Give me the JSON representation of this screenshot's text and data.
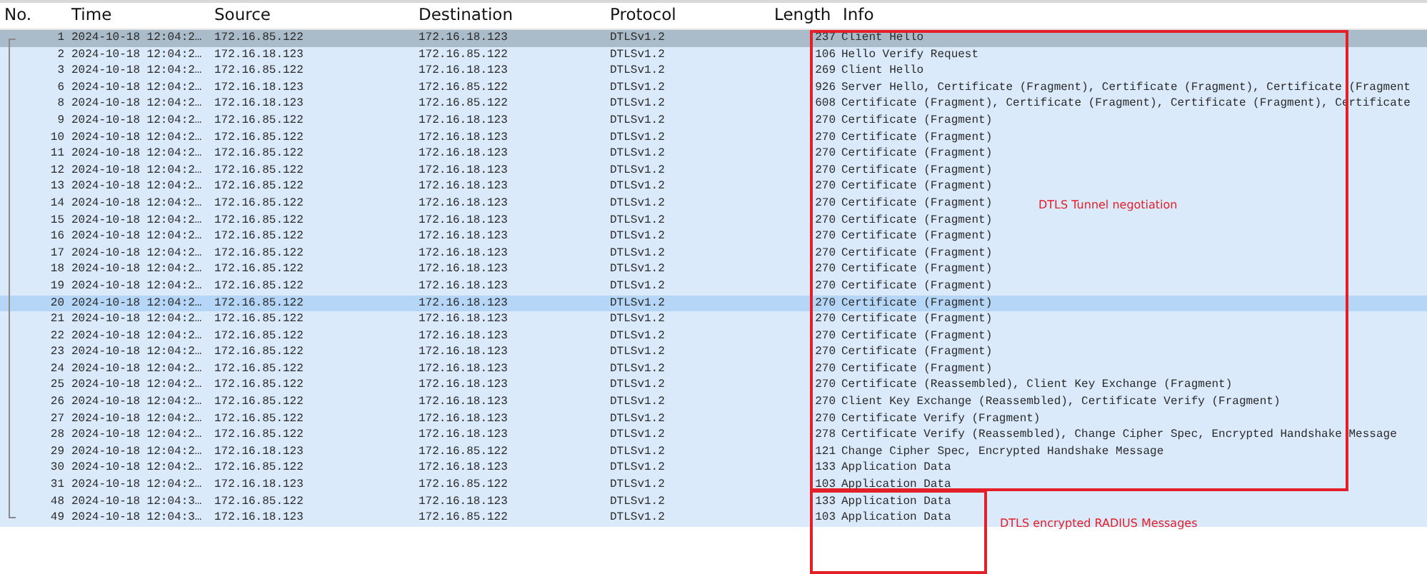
{
  "columns": [
    "No.",
    "Time",
    "Source",
    "Destination",
    "Protocol",
    "Length",
    "Info"
  ],
  "packets": [
    {
      "no": "1",
      "time": "2024-10-18 12:04:2…",
      "source": "172.16.85.122",
      "destination": "172.16.18.123",
      "protocol": "DTLSv1.2",
      "length": "237",
      "info": "Client Hello",
      "selected": true,
      "hovered": false
    },
    {
      "no": "2",
      "time": "2024-10-18 12:04:2…",
      "source": "172.16.18.123",
      "destination": "172.16.85.122",
      "protocol": "DTLSv1.2",
      "length": "106",
      "info": "Hello Verify Request",
      "selected": false,
      "hovered": false
    },
    {
      "no": "3",
      "time": "2024-10-18 12:04:2…",
      "source": "172.16.85.122",
      "destination": "172.16.18.123",
      "protocol": "DTLSv1.2",
      "length": "269",
      "info": "Client Hello",
      "selected": false,
      "hovered": false
    },
    {
      "no": "6",
      "time": "2024-10-18 12:04:2…",
      "source": "172.16.18.123",
      "destination": "172.16.85.122",
      "protocol": "DTLSv1.2",
      "length": "926",
      "info": "Server Hello, Certificate (Fragment), Certificate (Fragment), Certificate (Fragment",
      "selected": false,
      "hovered": false
    },
    {
      "no": "8",
      "time": "2024-10-18 12:04:2…",
      "source": "172.16.18.123",
      "destination": "172.16.85.122",
      "protocol": "DTLSv1.2",
      "length": "608",
      "info": "Certificate (Fragment), Certificate (Fragment), Certificate (Fragment), Certificate",
      "selected": false,
      "hovered": false
    },
    {
      "no": "9",
      "time": "2024-10-18 12:04:2…",
      "source": "172.16.85.122",
      "destination": "172.16.18.123",
      "protocol": "DTLSv1.2",
      "length": "270",
      "info": "Certificate (Fragment)",
      "selected": false,
      "hovered": false
    },
    {
      "no": "10",
      "time": "2024-10-18 12:04:2…",
      "source": "172.16.85.122",
      "destination": "172.16.18.123",
      "protocol": "DTLSv1.2",
      "length": "270",
      "info": "Certificate (Fragment)",
      "selected": false,
      "hovered": false
    },
    {
      "no": "11",
      "time": "2024-10-18 12:04:2…",
      "source": "172.16.85.122",
      "destination": "172.16.18.123",
      "protocol": "DTLSv1.2",
      "length": "270",
      "info": "Certificate (Fragment)",
      "selected": false,
      "hovered": false
    },
    {
      "no": "12",
      "time": "2024-10-18 12:04:2…",
      "source": "172.16.85.122",
      "destination": "172.16.18.123",
      "protocol": "DTLSv1.2",
      "length": "270",
      "info": "Certificate (Fragment)",
      "selected": false,
      "hovered": false
    },
    {
      "no": "13",
      "time": "2024-10-18 12:04:2…",
      "source": "172.16.85.122",
      "destination": "172.16.18.123",
      "protocol": "DTLSv1.2",
      "length": "270",
      "info": "Certificate (Fragment)",
      "selected": false,
      "hovered": false
    },
    {
      "no": "14",
      "time": "2024-10-18 12:04:2…",
      "source": "172.16.85.122",
      "destination": "172.16.18.123",
      "protocol": "DTLSv1.2",
      "length": "270",
      "info": "Certificate (Fragment)",
      "selected": false,
      "hovered": false
    },
    {
      "no": "15",
      "time": "2024-10-18 12:04:2…",
      "source": "172.16.85.122",
      "destination": "172.16.18.123",
      "protocol": "DTLSv1.2",
      "length": "270",
      "info": "Certificate (Fragment)",
      "selected": false,
      "hovered": false
    },
    {
      "no": "16",
      "time": "2024-10-18 12:04:2…",
      "source": "172.16.85.122",
      "destination": "172.16.18.123",
      "protocol": "DTLSv1.2",
      "length": "270",
      "info": "Certificate (Fragment)",
      "selected": false,
      "hovered": false
    },
    {
      "no": "17",
      "time": "2024-10-18 12:04:2…",
      "source": "172.16.85.122",
      "destination": "172.16.18.123",
      "protocol": "DTLSv1.2",
      "length": "270",
      "info": "Certificate (Fragment)",
      "selected": false,
      "hovered": false
    },
    {
      "no": "18",
      "time": "2024-10-18 12:04:2…",
      "source": "172.16.85.122",
      "destination": "172.16.18.123",
      "protocol": "DTLSv1.2",
      "length": "270",
      "info": "Certificate (Fragment)",
      "selected": false,
      "hovered": false
    },
    {
      "no": "19",
      "time": "2024-10-18 12:04:2…",
      "source": "172.16.85.122",
      "destination": "172.16.18.123",
      "protocol": "DTLSv1.2",
      "length": "270",
      "info": "Certificate (Fragment)",
      "selected": false,
      "hovered": false
    },
    {
      "no": "20",
      "time": "2024-10-18 12:04:2…",
      "source": "172.16.85.122",
      "destination": "172.16.18.123",
      "protocol": "DTLSv1.2",
      "length": "270",
      "info": "Certificate (Fragment)",
      "selected": false,
      "hovered": true
    },
    {
      "no": "21",
      "time": "2024-10-18 12:04:2…",
      "source": "172.16.85.122",
      "destination": "172.16.18.123",
      "protocol": "DTLSv1.2",
      "length": "270",
      "info": "Certificate (Fragment)",
      "selected": false,
      "hovered": false
    },
    {
      "no": "22",
      "time": "2024-10-18 12:04:2…",
      "source": "172.16.85.122",
      "destination": "172.16.18.123",
      "protocol": "DTLSv1.2",
      "length": "270",
      "info": "Certificate (Fragment)",
      "selected": false,
      "hovered": false
    },
    {
      "no": "23",
      "time": "2024-10-18 12:04:2…",
      "source": "172.16.85.122",
      "destination": "172.16.18.123",
      "protocol": "DTLSv1.2",
      "length": "270",
      "info": "Certificate (Fragment)",
      "selected": false,
      "hovered": false
    },
    {
      "no": "24",
      "time": "2024-10-18 12:04:2…",
      "source": "172.16.85.122",
      "destination": "172.16.18.123",
      "protocol": "DTLSv1.2",
      "length": "270",
      "info": "Certificate (Fragment)",
      "selected": false,
      "hovered": false
    },
    {
      "no": "25",
      "time": "2024-10-18 12:04:2…",
      "source": "172.16.85.122",
      "destination": "172.16.18.123",
      "protocol": "DTLSv1.2",
      "length": "270",
      "info": "Certificate (Reassembled), Client Key Exchange (Fragment)",
      "selected": false,
      "hovered": false
    },
    {
      "no": "26",
      "time": "2024-10-18 12:04:2…",
      "source": "172.16.85.122",
      "destination": "172.16.18.123",
      "protocol": "DTLSv1.2",
      "length": "270",
      "info": "Client Key Exchange (Reassembled), Certificate Verify (Fragment)",
      "selected": false,
      "hovered": false
    },
    {
      "no": "27",
      "time": "2024-10-18 12:04:2…",
      "source": "172.16.85.122",
      "destination": "172.16.18.123",
      "protocol": "DTLSv1.2",
      "length": "270",
      "info": "Certificate Verify (Fragment)",
      "selected": false,
      "hovered": false
    },
    {
      "no": "28",
      "time": "2024-10-18 12:04:2…",
      "source": "172.16.85.122",
      "destination": "172.16.18.123",
      "protocol": "DTLSv1.2",
      "length": "278",
      "info": "Certificate Verify (Reassembled), Change Cipher Spec, Encrypted Handshake Message",
      "selected": false,
      "hovered": false
    },
    {
      "no": "29",
      "time": "2024-10-18 12:04:2…",
      "source": "172.16.18.123",
      "destination": "172.16.85.122",
      "protocol": "DTLSv1.2",
      "length": "121",
      "info": "Change Cipher Spec, Encrypted Handshake Message",
      "selected": false,
      "hovered": false
    },
    {
      "no": "30",
      "time": "2024-10-18 12:04:2…",
      "source": "172.16.85.122",
      "destination": "172.16.18.123",
      "protocol": "DTLSv1.2",
      "length": "133",
      "info": "Application Data",
      "selected": false,
      "hovered": false
    },
    {
      "no": "31",
      "time": "2024-10-18 12:04:2…",
      "source": "172.16.18.123",
      "destination": "172.16.85.122",
      "protocol": "DTLSv1.2",
      "length": "103",
      "info": "Application Data",
      "selected": false,
      "hovered": false
    },
    {
      "no": "48",
      "time": "2024-10-18 12:04:3…",
      "source": "172.16.85.122",
      "destination": "172.16.18.123",
      "protocol": "DTLSv1.2",
      "length": "133",
      "info": "Application Data",
      "selected": false,
      "hovered": false
    },
    {
      "no": "49",
      "time": "2024-10-18 12:04:3…",
      "source": "172.16.18.123",
      "destination": "172.16.85.122",
      "protocol": "DTLSv1.2",
      "length": "103",
      "info": "Application Data",
      "selected": false,
      "hovered": false
    }
  ],
  "annotations": [
    {
      "label": "DTLS Tunnel negotiation"
    },
    {
      "label": "DTLS encrypted RADIUS Messages"
    }
  ]
}
